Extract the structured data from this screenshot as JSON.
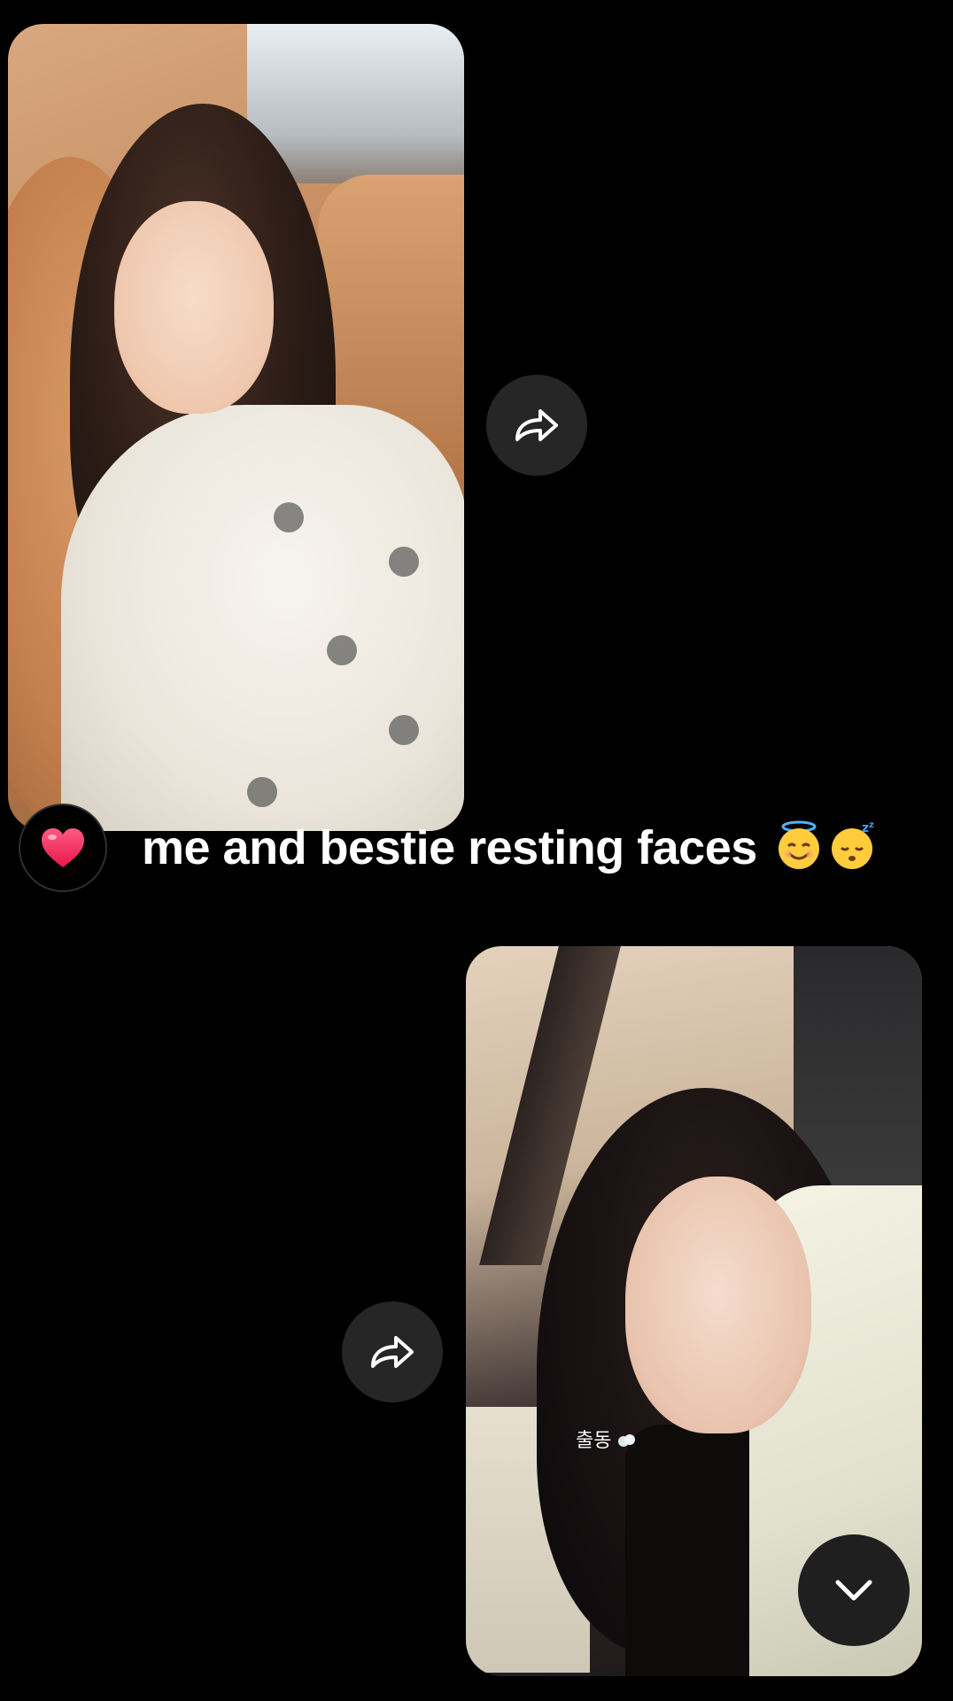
{
  "message": {
    "caption": "me and bestie resting faces",
    "reaction": "heart"
  },
  "photos": [
    {
      "alt": "selfie-resting-on-couch"
    },
    {
      "alt": "selfie-in-car",
      "sticker_text": "출동"
    }
  ],
  "icons": {
    "share": "share-arrow-icon",
    "reaction": "heart-icon",
    "scroll_down": "chevron-down-icon",
    "emoji_1": "smiling-face-with-halo",
    "emoji_2": "sleeping-face"
  },
  "colors": {
    "background": "#000000",
    "button": "#262626",
    "heart": "#ff2f62"
  }
}
